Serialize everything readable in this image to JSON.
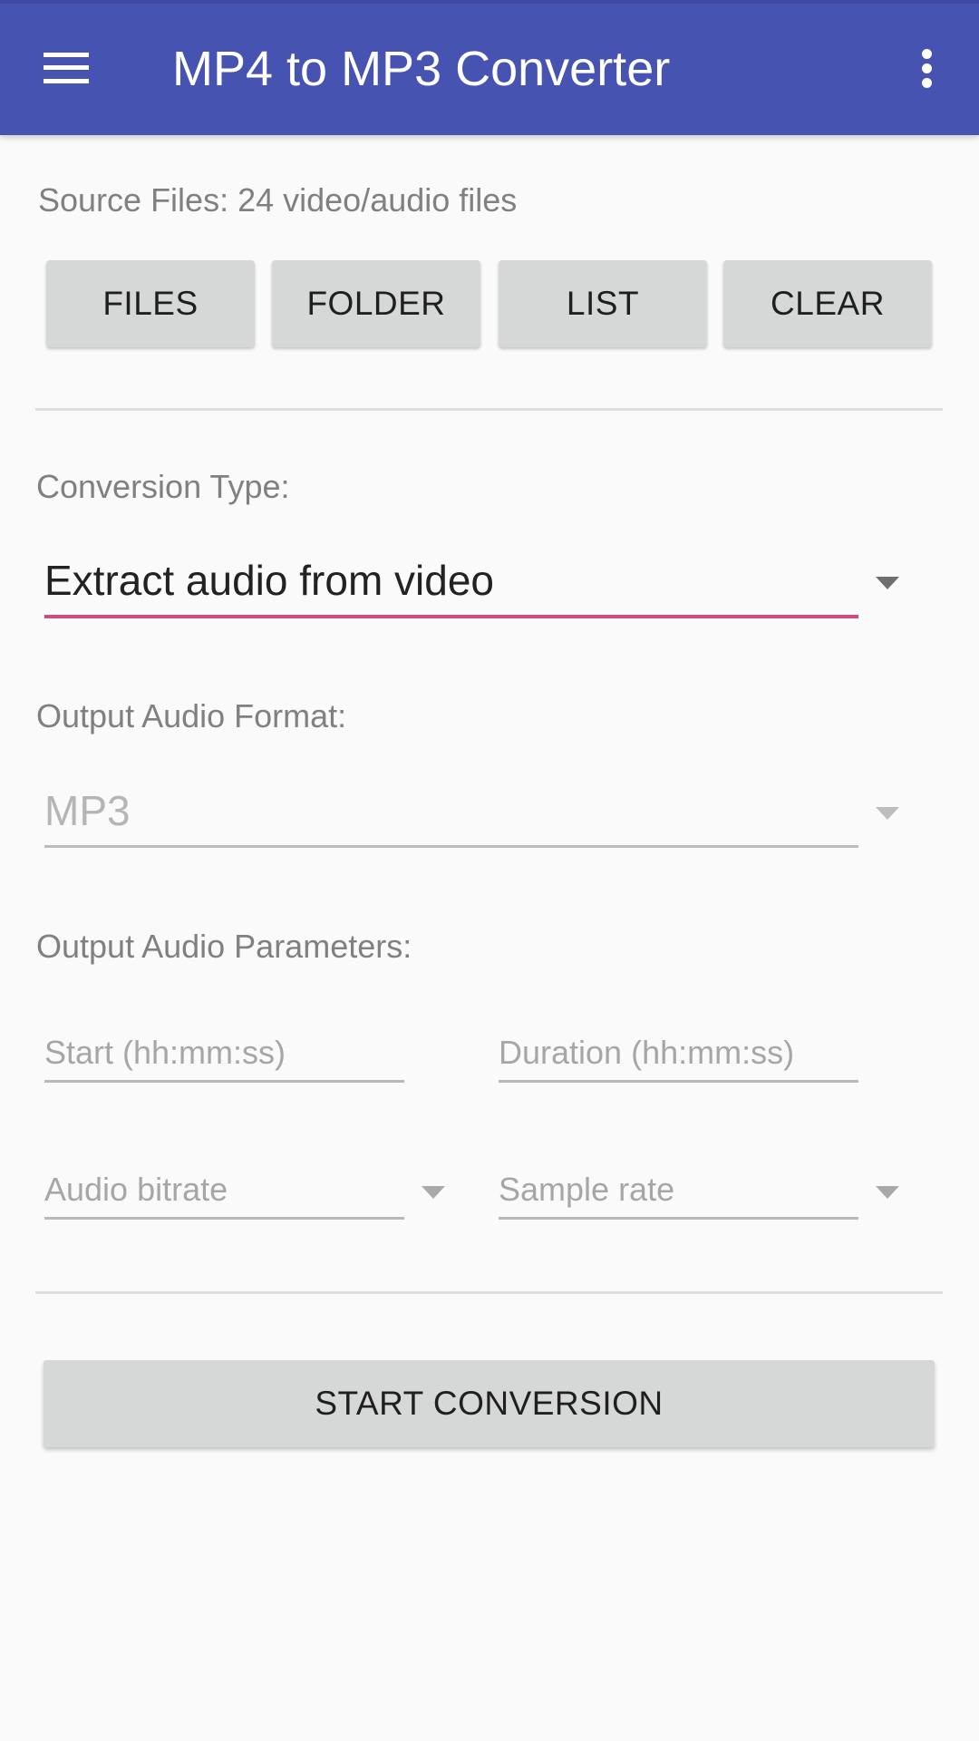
{
  "app": {
    "title": "MP4 to MP3 Converter",
    "menu_icon": "hamburger-menu-icon",
    "overflow_icon": "more-vert-icon",
    "colors": {
      "toolbar": "#4753b0",
      "accent": "#d14b7e",
      "button": "#d6d7d7",
      "background": "#fafafa"
    }
  },
  "source": {
    "label": "Source Files: 24 video/audio files",
    "buttons": [
      {
        "label": "FILES"
      },
      {
        "label": "FOLDER"
      },
      {
        "label": "LIST"
      },
      {
        "label": "CLEAR"
      }
    ]
  },
  "conversion_type": {
    "label": "Conversion Type:",
    "selected": "Extract audio from video"
  },
  "output_format": {
    "label": "Output Audio Format:",
    "selected": "MP3"
  },
  "output_params": {
    "label": "Output Audio Parameters:",
    "start_placeholder": "Start (hh:mm:ss)",
    "start_value": "",
    "duration_placeholder": "Duration (hh:mm:ss)",
    "duration_value": "",
    "bitrate_placeholder": "Audio bitrate",
    "sample_rate_placeholder": "Sample rate"
  },
  "actions": {
    "start_label": "START CONVERSION"
  }
}
